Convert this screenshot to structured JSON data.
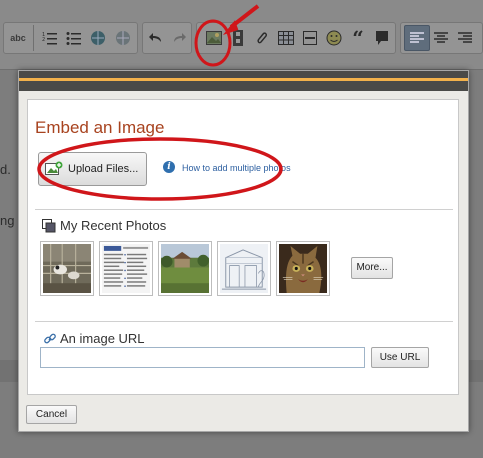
{
  "toolbar": {
    "spellcheck_label": "abc",
    "buttons": [
      "spellcheck-icon",
      "numbered-list-icon",
      "bullet-list-icon",
      "link-icon",
      "unlink-icon",
      "undo-icon",
      "redo-icon",
      "image-icon",
      "video-icon",
      "attachment-icon",
      "table-icon",
      "horizontal-rule-icon",
      "emoticon-icon",
      "quote-icon",
      "speech-bubble-icon",
      "align-left-icon",
      "align-center-icon",
      "align-right-icon"
    ],
    "active_button": "align-left-icon"
  },
  "background_text": {
    "line1_fragment": "d.",
    "line2_fragment": "ng |"
  },
  "dialog": {
    "title": "Embed an Image",
    "upload_button_label": "Upload Files...",
    "help_link_text": "How to add multiple photos",
    "recent_photos_heading": "My Recent Photos",
    "recent_photos": [
      {
        "name": "photo-animals-pen"
      },
      {
        "name": "photo-document-screenshot"
      },
      {
        "name": "photo-village-landscape"
      },
      {
        "name": "photo-building-sketch"
      },
      {
        "name": "photo-tabby-cat"
      }
    ],
    "more_button_label": "More...",
    "image_url_heading": "An image URL",
    "image_url_value": "",
    "use_url_button_label": "Use URL",
    "cancel_button_label": "Cancel"
  },
  "colors": {
    "title": "#a8431f",
    "accent_bar": "#f2b14b",
    "link": "#2c5fa0",
    "annotation": "#d0161a"
  }
}
